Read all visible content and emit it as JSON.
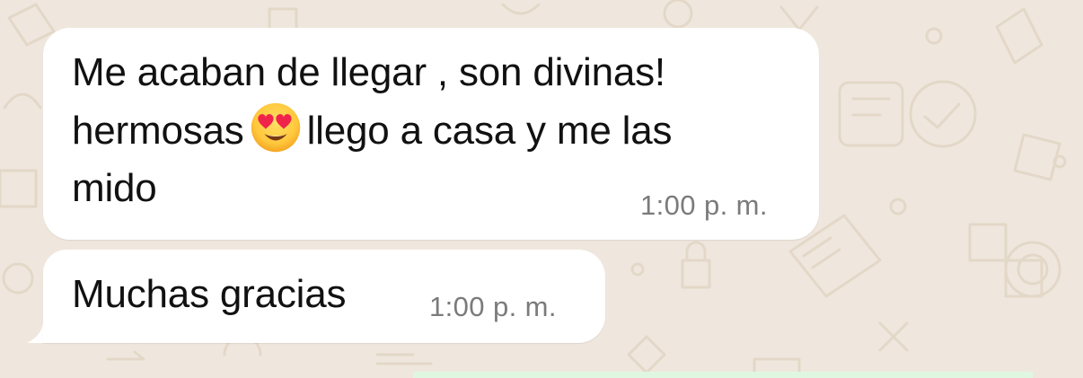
{
  "chat": {
    "background_color": "#efe7dd",
    "bubble_color": "#ffffff",
    "messages": [
      {
        "lines": [
          "Me acaban de llegar , son divinas!",
          "hermosas",
          "llego a casa y me las",
          "mido"
        ],
        "emoji": "heart-eyes-emoji",
        "time": "1:00 p. m."
      },
      {
        "text": "Muchas gracias",
        "time": "1:00 p. m."
      }
    ]
  }
}
